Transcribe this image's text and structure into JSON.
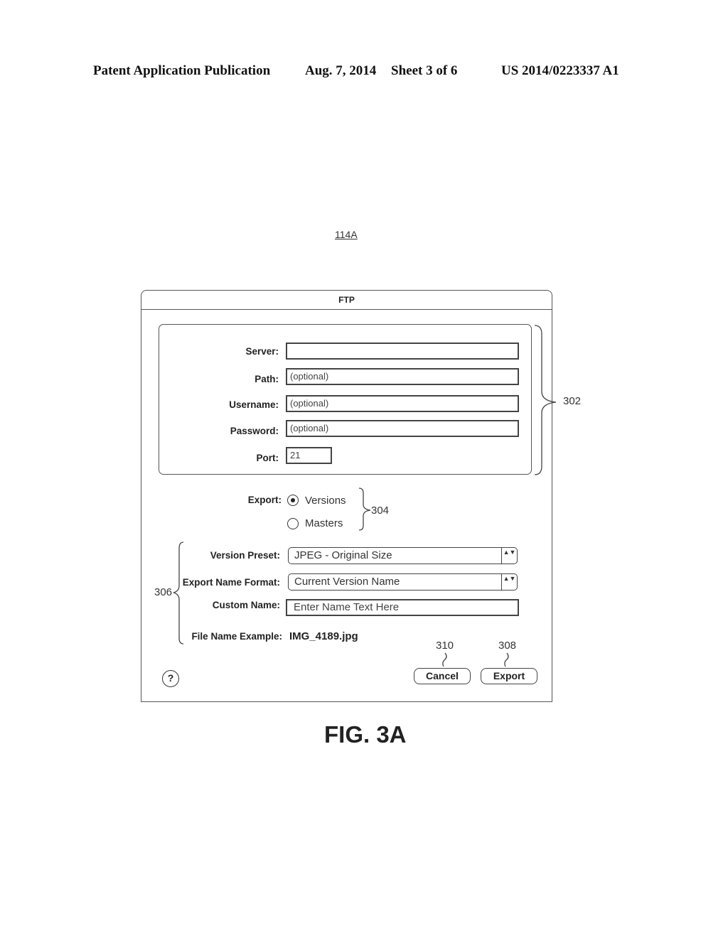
{
  "header": {
    "publication": "Patent Application Publication",
    "date": "Aug. 7, 2014",
    "sheet": "Sheet 3 of 6",
    "number": "US 2014/0223337 A1"
  },
  "figure_ref": "114A",
  "figure_caption": "FIG. 3A",
  "dialog": {
    "title": "FTP",
    "server": {
      "label": "Server:",
      "value": ""
    },
    "path": {
      "label": "Path:",
      "placeholder": "(optional)"
    },
    "username": {
      "label": "Username:",
      "placeholder": "(optional)"
    },
    "password": {
      "label": "Password:",
      "placeholder": "(optional)"
    },
    "port": {
      "label": "Port:",
      "value": "21"
    },
    "export": {
      "label": "Export:",
      "options": [
        {
          "label": "Versions",
          "selected": true
        },
        {
          "label": "Masters",
          "selected": false
        }
      ]
    },
    "version_preset": {
      "label": "Version Preset:",
      "value": "JPEG - Original Size"
    },
    "export_name_format": {
      "label": "Export Name Format:",
      "value": "Current Version Name"
    },
    "custom_name": {
      "label": "Custom Name:",
      "placeholder": "Enter Name Text Here"
    },
    "file_name_example": {
      "label": "File Name Example:",
      "value": "IMG_4189.jpg"
    },
    "cancel_label": "Cancel",
    "export_label": "Export",
    "help_glyph": "?",
    "select_arrows_glyph": "▲▼"
  },
  "annotations": {
    "group_302": "302",
    "export_304": "304",
    "naming_306": "306",
    "export_button_308": "308",
    "cancel_button_310": "310"
  }
}
